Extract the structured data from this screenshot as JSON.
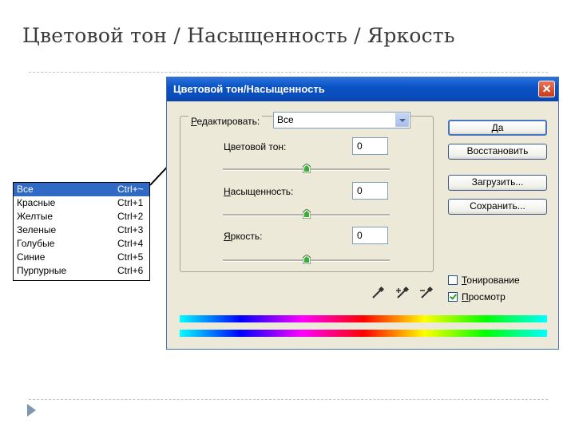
{
  "slide": {
    "title": "Цветовой тон / Насыщенность / Яркость"
  },
  "dialog": {
    "title": "Цветовой тон/Насыщенность",
    "edit": {
      "label_accel": "Р",
      "label_rest": "едактировать:",
      "value": "Все"
    },
    "rows": [
      {
        "label_pre": "Цветовой тон:",
        "label_accel": "",
        "label_post": "",
        "value": "0",
        "slider": 0.5
      },
      {
        "label_pre": "",
        "label_accel": "Н",
        "label_post": "асыщенность:",
        "value": "0",
        "slider": 0.5
      },
      {
        "label_pre": "",
        "label_accel": "Я",
        "label_post": "ркость:",
        "value": "0",
        "slider": 0.5
      }
    ],
    "buttons": {
      "ok": "Да",
      "reset": "Восстановить",
      "load": "Загрузить...",
      "save": "Сохранить..."
    },
    "checkboxes": [
      {
        "label_accel": "Т",
        "label_rest": "онирование",
        "checked": false
      },
      {
        "label_accel": "П",
        "label_rest": "росмотр",
        "checked": true
      }
    ],
    "icons": [
      "eyedropper-icon",
      "eyedropper-plus-icon",
      "eyedropper-minus-icon"
    ]
  },
  "menu": {
    "items": [
      {
        "name": "Все",
        "shortcut": "Ctrl+~",
        "selected": true
      },
      {
        "name": "Красные",
        "shortcut": "Ctrl+1",
        "selected": false
      },
      {
        "name": "Желтые",
        "shortcut": "Ctrl+2",
        "selected": false
      },
      {
        "name": "Зеленые",
        "shortcut": "Ctrl+3",
        "selected": false
      },
      {
        "name": "Голубые",
        "shortcut": "Ctrl+4",
        "selected": false
      },
      {
        "name": "Синие",
        "shortcut": "Ctrl+5",
        "selected": false
      },
      {
        "name": "Пурпурные",
        "shortcut": "Ctrl+6",
        "selected": false
      }
    ]
  },
  "colors": {
    "titlebar": "#0a53c4",
    "dialog_bg": "#ece9d8",
    "selection": "#316ac5"
  }
}
